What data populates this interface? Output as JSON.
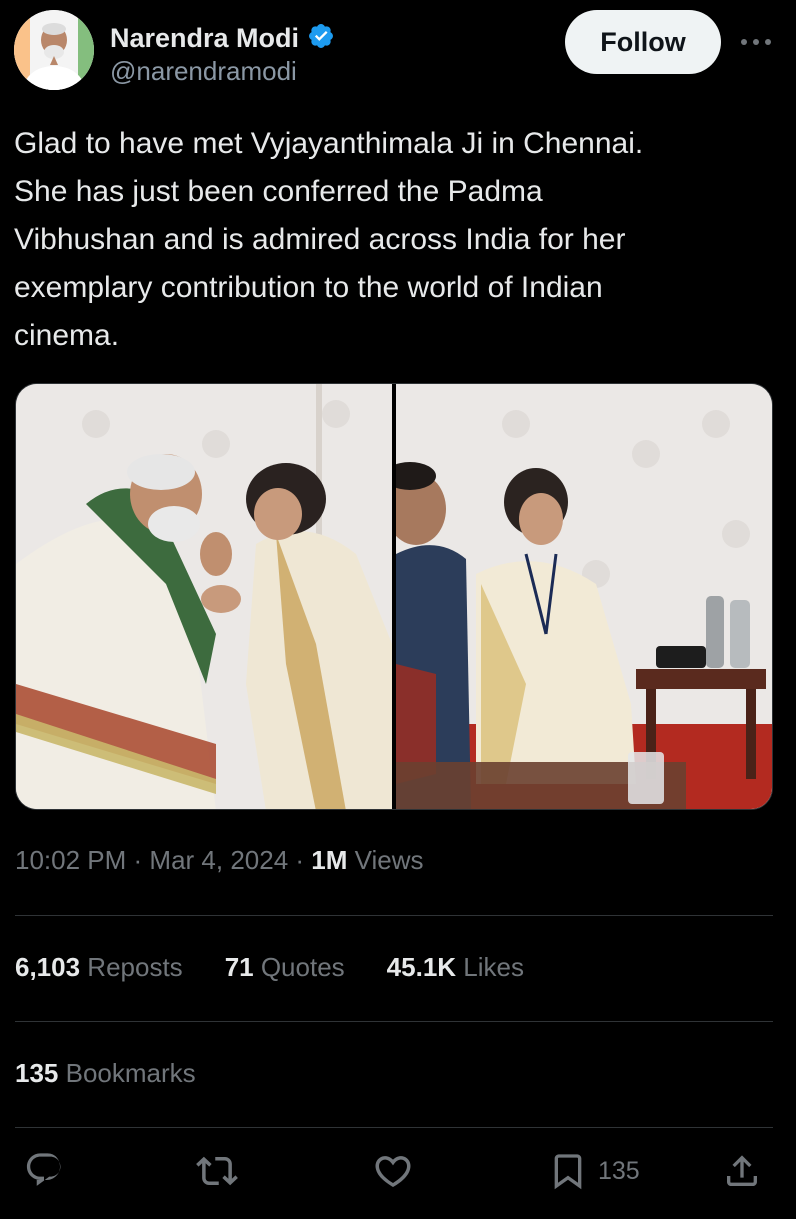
{
  "author": {
    "name": "Narendra Modi",
    "handle": "@narendramodi",
    "verified_icon": "verified-badge-icon",
    "verified_color": "#1d9bf0"
  },
  "header": {
    "follow_label": "Follow",
    "more_icon": "more-horizontal-icon"
  },
  "tweet": {
    "text": "Glad to have met Vyjayanthimala Ji in Chennai.\nShe has just been conferred the Padma\nVibhushan and is admired across India for her\nexemplary contribution to the world of Indian\ncinema."
  },
  "meta": {
    "time": "10:02 PM",
    "sep1": " · ",
    "date": "Mar 4, 2024",
    "sep2": " · ",
    "views_count": "1M",
    "views_label": " Views"
  },
  "stats": {
    "reposts_count": "6,103",
    "reposts_label": " Reposts",
    "quotes_count": "71",
    "quotes_label": " Quotes",
    "likes_count": "45.1K",
    "likes_label": " Likes",
    "bookmarks_count": "135",
    "bookmarks_label": " Bookmarks"
  },
  "actions": {
    "reply_icon": "reply-icon",
    "repost_icon": "repost-icon",
    "like_icon": "heart-icon",
    "bookmark_icon": "bookmark-icon",
    "bookmark_count": "135",
    "share_icon": "share-icon"
  },
  "colors": {
    "background": "#000000",
    "text": "#e7e9ea",
    "secondary": "#71767b",
    "divider": "#2f3336",
    "follow_bg": "#eff3f4"
  }
}
